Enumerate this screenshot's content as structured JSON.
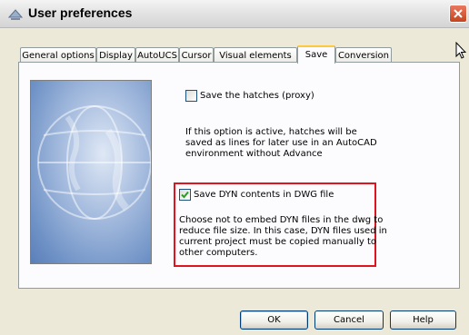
{
  "window": {
    "title": "User preferences"
  },
  "tabs": [
    {
      "label": "General options"
    },
    {
      "label": "Display"
    },
    {
      "label": "AutoUCS"
    },
    {
      "label": "Cursor"
    },
    {
      "label": "Visual elements"
    },
    {
      "label": "Save"
    },
    {
      "label": "Conversion"
    }
  ],
  "active_tab": "Save",
  "options": {
    "save_hatches": {
      "label": "Save the hatches (proxy)",
      "checked": false,
      "description": "If this option is active, hatches will be\nsaved as lines for later use in an AutoCAD\nenvironment without Advance"
    },
    "save_dyn": {
      "label": "Save DYN contents in DWG file",
      "checked": true,
      "description": "Choose not to embed DYN files in the dwg to\nreduce file size. In this case, DYN files used in\ncurrent project must be copied manually to\nother computers."
    }
  },
  "buttons": {
    "ok": "OK",
    "cancel": "Cancel",
    "help": "Help"
  },
  "colors": {
    "highlight": "#e0141e",
    "active_tab": "#ffc83c",
    "close": "#c5441f"
  }
}
